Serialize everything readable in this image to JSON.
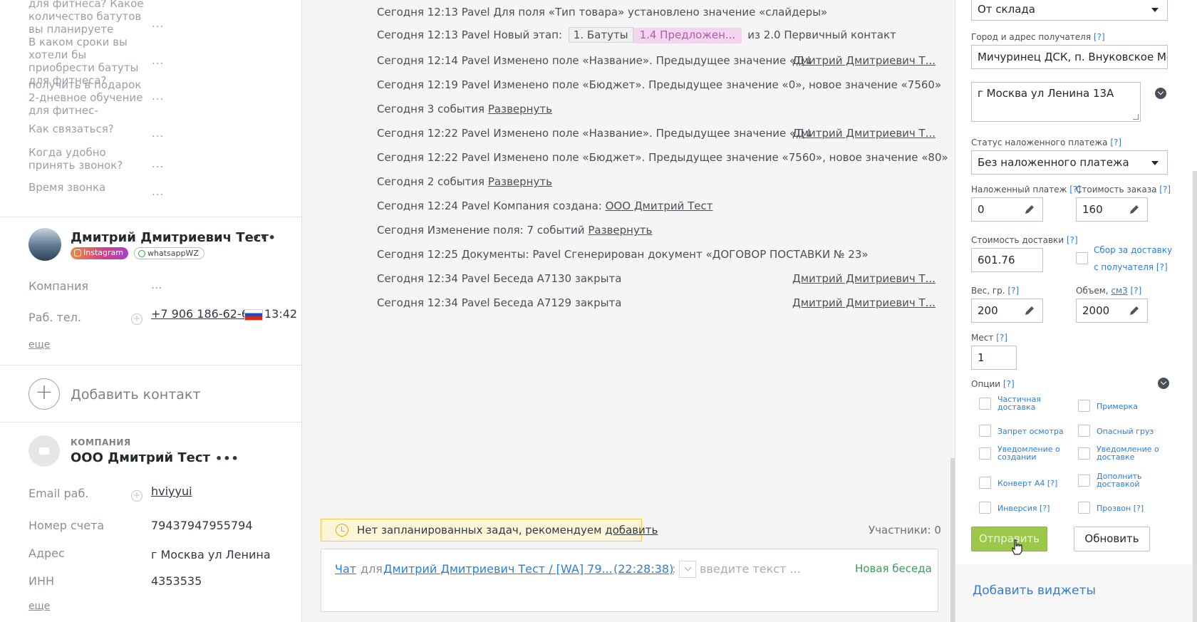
{
  "left": {
    "questions": [
      {
        "text": "для фитнеса?\nКакое количество батутов вы планируете",
        "value": "..."
      },
      {
        "text": "В каком сроки вы хотели бы приобрести батуты для фитнеса?",
        "value": "..."
      },
      {
        "text": "получить в подарок 2-дневное обучение для фитнес-",
        "value": "..."
      },
      {
        "text": "Как связаться?",
        "value": "..."
      },
      {
        "text": "Когда удобно принять звонок?",
        "value": "..."
      },
      {
        "text": "Время звонка",
        "value": "..."
      }
    ],
    "contact": {
      "name": "Дмитрий Дмитриевич Тест",
      "tag_instagram": "Instagram",
      "tag_whatsapp": "whatsappWZ",
      "company_label": "Компания",
      "company_value": "...",
      "phone_label": "Раб. тел.",
      "phone_value": "+7 906 186-62-6",
      "phone_time": "13:42",
      "more": "еще"
    },
    "add_contact": "Добавить контакт",
    "company": {
      "kicker": "КОМПАНИЯ",
      "name": "ООО Дмитрий Тест",
      "fields": [
        {
          "label": "Email раб.",
          "value": "hviyyui"
        },
        {
          "label": "Номер счета",
          "value": "79437947955794"
        },
        {
          "label": "Адрес",
          "value": "г Москва ул Ленина"
        },
        {
          "label": "ИНН",
          "value": "4353535"
        }
      ],
      "more": "еще"
    }
  },
  "feed": {
    "events": [
      {
        "prefix": "Сегодня 12:13 Pavel Для поля «Тип товара» установлено значение «слайдеры»"
      },
      {
        "prefix": "Сегодня 12:13 Pavel Новый этап:",
        "stage": "1. Батуты",
        "stage_pink": "1.4 Предложен...",
        "suffix": "из 2.0 Первичный контакт"
      },
      {
        "prefix": "Сегодня 12:14 Pavel Изменено поле «Название». Предыдущее значение «Д↓",
        "author": "Дмитрий Дмитриевич Т..."
      },
      {
        "prefix": "Сегодня 12:19 Pavel Изменено поле «Бюджет». Предыдущее значение «0», новое значение «7560»"
      },
      {
        "prefix": "Сегодня 3 события",
        "link": "Развернуть"
      },
      {
        "prefix": "Сегодня 12:22 Pavel Изменено поле «Название». Предыдущее значение «Д↓",
        "author": "Дмитрий Дмитриевич Т..."
      },
      {
        "prefix": "Сегодня 12:22 Pavel Изменено поле «Бюджет». Предыдущее значение «7560», новое значение «80»"
      },
      {
        "prefix": "Сегодня 2 события",
        "link": "Развернуть"
      },
      {
        "prefix": "Сегодня 12:24 Pavel Компания создана:",
        "link": "ООО Дмитрий Тест"
      },
      {
        "prefix": "Сегодня Изменение поля: 7 событий",
        "link": "Развернуть"
      },
      {
        "prefix": "Сегодня 12:25 Документы: Pavel Сгенерирован документ «ДОГОВОР ПОСТАВКИ № 23»"
      },
      {
        "prefix": "Сегодня 12:34 Pavel Беседа А7130 закрыта",
        "author": "Дмитрий Дмитриевич Т..."
      },
      {
        "prefix": "Сегодня 12:34 Pavel Беседа А7129 закрыта",
        "author": "Дмитрий Дмитриевич Т..."
      }
    ],
    "task_text": "Нет запланированных задач, рекомендуем",
    "task_link": "добавить",
    "participants": "Участники: 0",
    "chat": {
      "chat_link": "Чат",
      "for": "для",
      "target": "Дмитрий Дмитриевич Тест / [WA] 79...",
      "time": "(22:28:38)",
      "colon": ":",
      "placeholder": "введите текст ...",
      "new_conversation": "Новая беседа"
    }
  },
  "right": {
    "from_select": "От склада",
    "city_label": "Город и адрес получателя",
    "q": "[?]",
    "city_value": "Мичуринец ДСК, п. Внуковское Мос",
    "address_value": "г Москва ул Ленина 13А",
    "cod_status_label": "Статус наложенного платежа",
    "cod_status_value": "Без наложенного платежа",
    "cod_label": "Наложенный платеж",
    "cod_value": "0",
    "order_cost_label": "Стоимость заказа",
    "order_cost_value": "160",
    "delivery_cost_label": "Стоимость доставки",
    "delivery_cost_value": "601.76",
    "collect_label_1": "Сбор за доставку",
    "collect_label_2": "с получателя",
    "weight_label": "Вес, гр.",
    "weight_value": "200",
    "volume_label": "Объем,",
    "volume_unit": "см3",
    "volume_value": "2000",
    "places_label": "Мест",
    "places_value": "1",
    "options_label": "Опции",
    "options": [
      {
        "label": "Частичная доставка"
      },
      {
        "label": "Примерка"
      },
      {
        "label": "Запрет осмотра"
      },
      {
        "label": "Опасный груз"
      },
      {
        "label": "Уведомление о создании"
      },
      {
        "label": "Уведомление о доставке"
      },
      {
        "label": "Конверт А4 [?]"
      },
      {
        "label": "Дополнить доставкой"
      },
      {
        "label": "Инверсия [?]"
      },
      {
        "label": "Прозвон [?]"
      }
    ],
    "send_button": "Отправить",
    "update_button": "Обновить",
    "add_widgets": "Добавить виджеты"
  }
}
